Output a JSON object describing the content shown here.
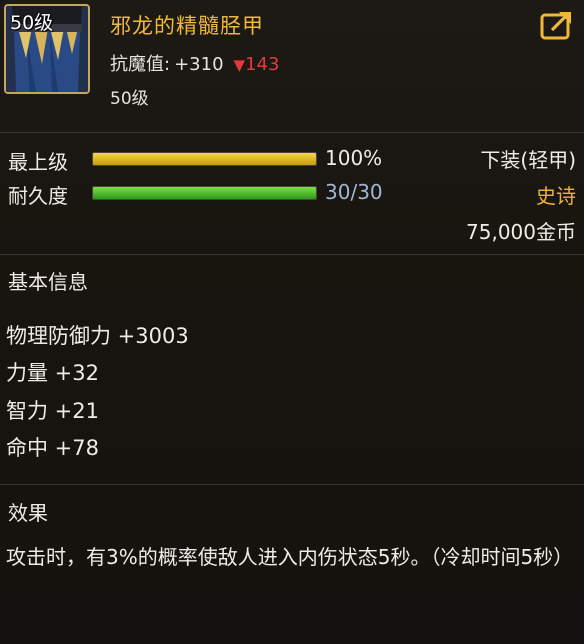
{
  "item": {
    "icon_level": "50级",
    "name": "邪龙的精髓胫甲",
    "resist_label": "抗魔值:",
    "resist_value": "+310",
    "resist_diff": "143",
    "level": "50级",
    "icon_name": "armored-greaves-icon"
  },
  "stats": {
    "top_label": "最上级",
    "top_value": "100%",
    "top_fraction": 1.0,
    "durability_label": "耐久度",
    "durability_value": "30/30",
    "durability_fraction": 1.0
  },
  "info": {
    "slot": "下装(轻甲)",
    "rarity": "史诗",
    "price": "75,000金币"
  },
  "basic": {
    "title": "基本信息",
    "attrs": [
      "物理防御力 +3003",
      "力量 +32",
      "智力 +21",
      "命中 +78"
    ]
  },
  "effect": {
    "title": "效果",
    "text": "攻击时，有3%的概率使敌人进入内伤状态5秒。（冷却时间5秒）"
  },
  "colors": {
    "name": "#f2b83a",
    "rarity": "#f0b13a",
    "decrease": "#e03b3b",
    "durability_text": "#9fb6d6",
    "frame": "#c6a65a"
  }
}
